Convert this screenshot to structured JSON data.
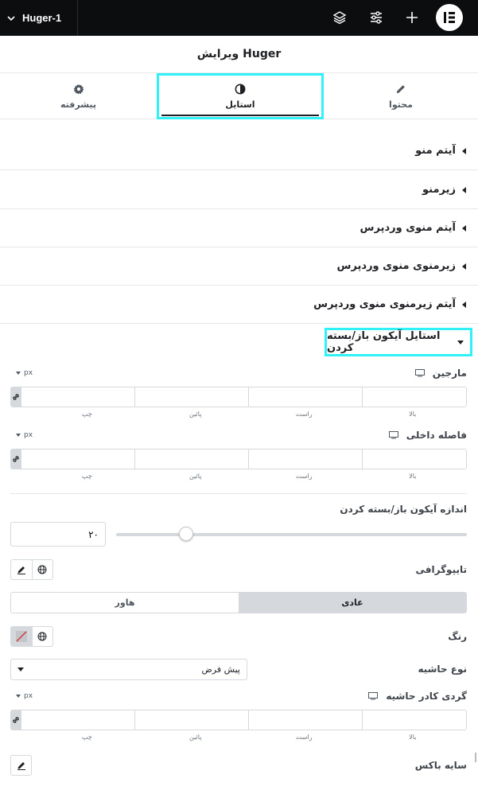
{
  "topbar": {
    "document_title": "Huger-1",
    "icons": [
      "chevron-down-icon",
      "layers-icon",
      "sliders-icon",
      "plus-icon",
      "elementor-logo"
    ]
  },
  "panel": {
    "title": "ویرایش Huger"
  },
  "tabs": [
    {
      "label": "پیشرفته",
      "icon": "gear-icon"
    },
    {
      "label": "استایل",
      "icon": "contrast-icon",
      "active": true
    },
    {
      "label": "محتوا",
      "icon": "pencil-icon"
    }
  ],
  "sections": [
    {
      "label": "آیتم منو"
    },
    {
      "label": "زیرمنو"
    },
    {
      "label": "آیتم منوی وردپرس"
    },
    {
      "label": "زیرمنوی منوی وردپرس"
    },
    {
      "label": "آیتم زیرمنوی منوی وردپرس"
    }
  ],
  "open_section": {
    "label": "استایل آیکون باز/بسته کردن"
  },
  "margin": {
    "label": "مارجین",
    "unit": "px",
    "sides": [
      "چپ",
      "پائین",
      "راست",
      "بالا"
    ]
  },
  "padding": {
    "label": "فاصله داخلی",
    "unit": "px",
    "sides": [
      "چپ",
      "پائین",
      "راست",
      "بالا"
    ]
  },
  "icon_size": {
    "label": "اندازه آیکون باز/بسته کردن",
    "value": "۲۰",
    "slider_fraction": 0.2
  },
  "typography": {
    "label": "تایپوگرافی"
  },
  "state_switch": {
    "hover": "هاور",
    "normal": "عادی",
    "active": "normal"
  },
  "color": {
    "label": "رنگ"
  },
  "border_type": {
    "label": "نوع حاشیه",
    "value": "پیش فرض"
  },
  "border_radius": {
    "label": "گردی کادر حاشیه",
    "unit": "px",
    "sides": [
      "چپ",
      "پائین",
      "راست",
      "بالا"
    ]
  },
  "box_shadow": {
    "label": "سایه باکس"
  },
  "colors": {
    "highlight": "#2ff1f7",
    "topbar": "#0c0d0e",
    "border": "#d5d8dc"
  }
}
